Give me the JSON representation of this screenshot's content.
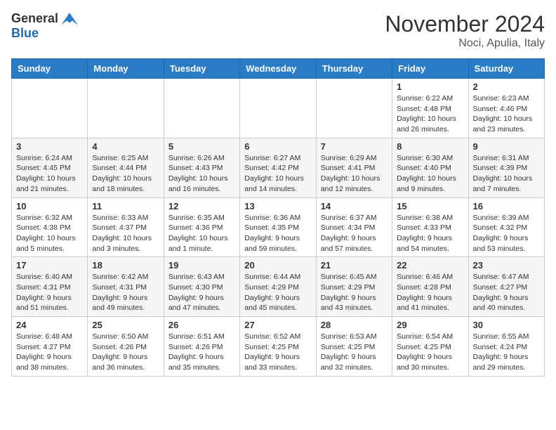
{
  "header": {
    "logo_general": "General",
    "logo_blue": "Blue",
    "month_title": "November 2024",
    "location": "Noci, Apulia, Italy"
  },
  "days_of_week": [
    "Sunday",
    "Monday",
    "Tuesday",
    "Wednesday",
    "Thursday",
    "Friday",
    "Saturday"
  ],
  "weeks": [
    [
      {
        "day": "",
        "detail": ""
      },
      {
        "day": "",
        "detail": ""
      },
      {
        "day": "",
        "detail": ""
      },
      {
        "day": "",
        "detail": ""
      },
      {
        "day": "",
        "detail": ""
      },
      {
        "day": "1",
        "detail": "Sunrise: 6:22 AM\nSunset: 4:48 PM\nDaylight: 10 hours and 26 minutes."
      },
      {
        "day": "2",
        "detail": "Sunrise: 6:23 AM\nSunset: 4:46 PM\nDaylight: 10 hours and 23 minutes."
      }
    ],
    [
      {
        "day": "3",
        "detail": "Sunrise: 6:24 AM\nSunset: 4:45 PM\nDaylight: 10 hours and 21 minutes."
      },
      {
        "day": "4",
        "detail": "Sunrise: 6:25 AM\nSunset: 4:44 PM\nDaylight: 10 hours and 18 minutes."
      },
      {
        "day": "5",
        "detail": "Sunrise: 6:26 AM\nSunset: 4:43 PM\nDaylight: 10 hours and 16 minutes."
      },
      {
        "day": "6",
        "detail": "Sunrise: 6:27 AM\nSunset: 4:42 PM\nDaylight: 10 hours and 14 minutes."
      },
      {
        "day": "7",
        "detail": "Sunrise: 6:29 AM\nSunset: 4:41 PM\nDaylight: 10 hours and 12 minutes."
      },
      {
        "day": "8",
        "detail": "Sunrise: 6:30 AM\nSunset: 4:40 PM\nDaylight: 10 hours and 9 minutes."
      },
      {
        "day": "9",
        "detail": "Sunrise: 6:31 AM\nSunset: 4:39 PM\nDaylight: 10 hours and 7 minutes."
      }
    ],
    [
      {
        "day": "10",
        "detail": "Sunrise: 6:32 AM\nSunset: 4:38 PM\nDaylight: 10 hours and 5 minutes."
      },
      {
        "day": "11",
        "detail": "Sunrise: 6:33 AM\nSunset: 4:37 PM\nDaylight: 10 hours and 3 minutes."
      },
      {
        "day": "12",
        "detail": "Sunrise: 6:35 AM\nSunset: 4:36 PM\nDaylight: 10 hours and 1 minute."
      },
      {
        "day": "13",
        "detail": "Sunrise: 6:36 AM\nSunset: 4:35 PM\nDaylight: 9 hours and 59 minutes."
      },
      {
        "day": "14",
        "detail": "Sunrise: 6:37 AM\nSunset: 4:34 PM\nDaylight: 9 hours and 57 minutes."
      },
      {
        "day": "15",
        "detail": "Sunrise: 6:38 AM\nSunset: 4:33 PM\nDaylight: 9 hours and 54 minutes."
      },
      {
        "day": "16",
        "detail": "Sunrise: 6:39 AM\nSunset: 4:32 PM\nDaylight: 9 hours and 53 minutes."
      }
    ],
    [
      {
        "day": "17",
        "detail": "Sunrise: 6:40 AM\nSunset: 4:31 PM\nDaylight: 9 hours and 51 minutes."
      },
      {
        "day": "18",
        "detail": "Sunrise: 6:42 AM\nSunset: 4:31 PM\nDaylight: 9 hours and 49 minutes."
      },
      {
        "day": "19",
        "detail": "Sunrise: 6:43 AM\nSunset: 4:30 PM\nDaylight: 9 hours and 47 minutes."
      },
      {
        "day": "20",
        "detail": "Sunrise: 6:44 AM\nSunset: 4:29 PM\nDaylight: 9 hours and 45 minutes."
      },
      {
        "day": "21",
        "detail": "Sunrise: 6:45 AM\nSunset: 4:29 PM\nDaylight: 9 hours and 43 minutes."
      },
      {
        "day": "22",
        "detail": "Sunrise: 6:46 AM\nSunset: 4:28 PM\nDaylight: 9 hours and 41 minutes."
      },
      {
        "day": "23",
        "detail": "Sunrise: 6:47 AM\nSunset: 4:27 PM\nDaylight: 9 hours and 40 minutes."
      }
    ],
    [
      {
        "day": "24",
        "detail": "Sunrise: 6:48 AM\nSunset: 4:27 PM\nDaylight: 9 hours and 38 minutes."
      },
      {
        "day": "25",
        "detail": "Sunrise: 6:50 AM\nSunset: 4:26 PM\nDaylight: 9 hours and 36 minutes."
      },
      {
        "day": "26",
        "detail": "Sunrise: 6:51 AM\nSunset: 4:26 PM\nDaylight: 9 hours and 35 minutes."
      },
      {
        "day": "27",
        "detail": "Sunrise: 6:52 AM\nSunset: 4:25 PM\nDaylight: 9 hours and 33 minutes."
      },
      {
        "day": "28",
        "detail": "Sunrise: 6:53 AM\nSunset: 4:25 PM\nDaylight: 9 hours and 32 minutes."
      },
      {
        "day": "29",
        "detail": "Sunrise: 6:54 AM\nSunset: 4:25 PM\nDaylight: 9 hours and 30 minutes."
      },
      {
        "day": "30",
        "detail": "Sunrise: 6:55 AM\nSunset: 4:24 PM\nDaylight: 9 hours and 29 minutes."
      }
    ]
  ]
}
